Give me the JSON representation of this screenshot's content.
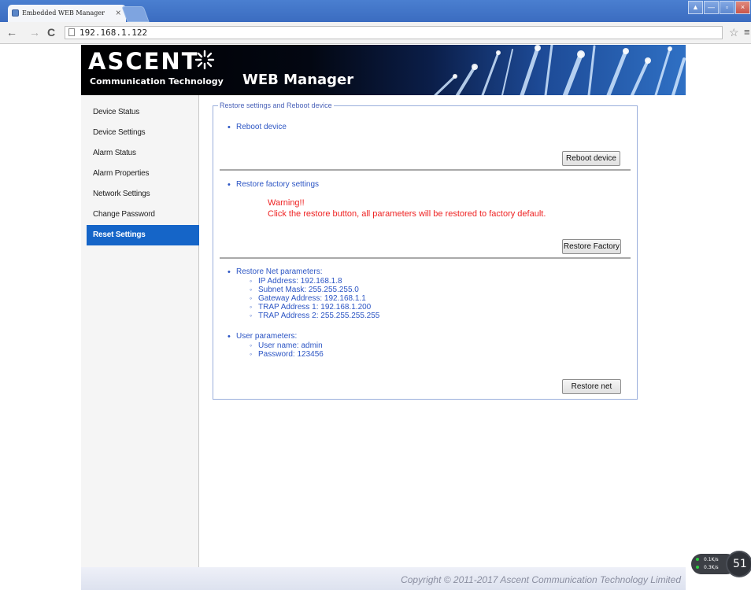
{
  "browser": {
    "tab_title": "Embedded WEB Manager",
    "tab_close": "×",
    "address": "192.168.1.122",
    "back": "←",
    "forward": "→",
    "reload": "C",
    "star": "☆",
    "menu": "≡",
    "window_controls": [
      "▲",
      "—",
      "▫",
      "×"
    ]
  },
  "header": {
    "logo_text": "ASCENT",
    "tagline": "Communication Technology",
    "app_title": "WEB Manager"
  },
  "sidebar": {
    "items": [
      {
        "label": "Device Status"
      },
      {
        "label": "Device Settings"
      },
      {
        "label": "Alarm Status"
      },
      {
        "label": "Alarm Properties"
      },
      {
        "label": "Network Settings"
      },
      {
        "label": "Change Password"
      },
      {
        "label": "Reset Settings",
        "active": true
      }
    ]
  },
  "panel": {
    "legend": "Restore settings and Reboot device",
    "reboot": {
      "title": "Reboot device",
      "button": "Reboot device"
    },
    "factory": {
      "title": "Restore factory settings",
      "warning_title": "Warning!!",
      "warning_text": "Click the restore button, all parameters will be restored to factory default.",
      "button": "Restore Factory"
    },
    "net": {
      "title": "Restore Net parameters:",
      "items": [
        "IP Address: 192.168.1.8",
        "Subnet Mask: 255.255.255.0",
        "Gateway Address: 192.168.1.1",
        "TRAP Address 1: 192.168.1.200",
        "TRAP Address 2: 255.255.255.255"
      ],
      "user_title": "User parameters:",
      "user_items": [
        "User name: admin",
        "Password: 123456"
      ],
      "button": "Restore net"
    }
  },
  "footer": {
    "copyright": "Copyright © 2011-2017 Ascent Communication Technology Limited"
  },
  "widget": {
    "up": "0.1K/s",
    "down": "0.3K/s",
    "value": "51"
  },
  "colors": {
    "accent": "#1565c8",
    "text_blue": "#2c55c4",
    "warning": "#ee2222"
  }
}
